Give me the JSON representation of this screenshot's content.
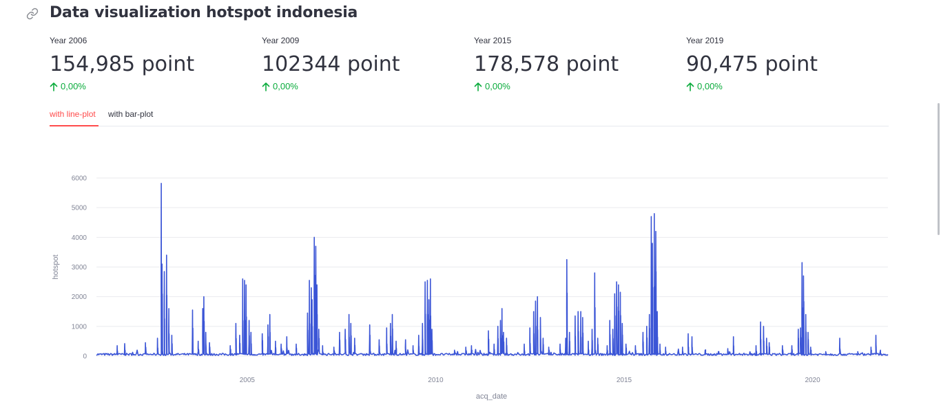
{
  "page": {
    "title": "Data visualization hotspot indonesia",
    "link_icon": "link-icon"
  },
  "metrics": [
    {
      "label": "Year 2006",
      "value": "154,985 point",
      "delta": "0,00%"
    },
    {
      "label": "Year 2009",
      "value": "102344 point",
      "delta": "0,00%"
    },
    {
      "label": "Year 2015",
      "value": "178,578 point",
      "delta": "0,00%"
    },
    {
      "label": "Year 2019",
      "value": "90,475 point",
      "delta": "0,00%"
    }
  ],
  "tabs": [
    {
      "label": "with line-plot",
      "active": true
    },
    {
      "label": "with bar-plot",
      "active": false
    }
  ],
  "colors": {
    "accent": "#ff4b4b",
    "delta_positive": "#09ab3b",
    "series": "#3b55d6",
    "text": "#31333f"
  },
  "chart_data": {
    "type": "line",
    "xlabel": "acq_date",
    "ylabel": "hotspot",
    "x_ticks": [
      "2005",
      "2010",
      "2015",
      "2020"
    ],
    "y_ticks": [
      "0",
      "1000",
      "2000",
      "3000",
      "4000",
      "5000",
      "6000"
    ],
    "xlim": [
      2001.0,
      2022.0
    ],
    "ylim": [
      0,
      6000
    ],
    "grid": true,
    "series": [
      {
        "peaks": [
          [
            2001.55,
            350
          ],
          [
            2001.75,
            420
          ],
          [
            2002.3,
            450
          ],
          [
            2002.62,
            600
          ],
          [
            2002.72,
            5820
          ],
          [
            2002.74,
            3100
          ],
          [
            2002.8,
            2850
          ],
          [
            2002.86,
            3400
          ],
          [
            2002.92,
            1600
          ],
          [
            2003.0,
            700
          ],
          [
            2003.55,
            1550
          ],
          [
            2003.7,
            500
          ],
          [
            2003.82,
            1600
          ],
          [
            2003.85,
            2000
          ],
          [
            2003.9,
            800
          ],
          [
            2004.0,
            450
          ],
          [
            2004.55,
            350
          ],
          [
            2004.7,
            1100
          ],
          [
            2004.8,
            700
          ],
          [
            2004.88,
            2600
          ],
          [
            2004.93,
            2550
          ],
          [
            2004.97,
            2400
          ],
          [
            2005.05,
            1200
          ],
          [
            2005.1,
            800
          ],
          [
            2005.4,
            750
          ],
          [
            2005.55,
            1050
          ],
          [
            2005.6,
            1400
          ],
          [
            2005.75,
            500
          ],
          [
            2005.9,
            400
          ],
          [
            2006.05,
            650
          ],
          [
            2006.3,
            400
          ],
          [
            2006.6,
            1450
          ],
          [
            2006.65,
            2550
          ],
          [
            2006.7,
            2300
          ],
          [
            2006.72,
            1900
          ],
          [
            2006.78,
            4000
          ],
          [
            2006.82,
            3700
          ],
          [
            2006.85,
            2400
          ],
          [
            2006.9,
            900
          ],
          [
            2007.0,
            350
          ],
          [
            2007.3,
            300
          ],
          [
            2007.45,
            800
          ],
          [
            2007.6,
            900
          ],
          [
            2007.7,
            1400
          ],
          [
            2007.75,
            1100
          ],
          [
            2007.85,
            600
          ],
          [
            2008.25,
            1050
          ],
          [
            2008.5,
            550
          ],
          [
            2008.7,
            950
          ],
          [
            2008.8,
            1100
          ],
          [
            2008.85,
            1400
          ],
          [
            2008.95,
            500
          ],
          [
            2009.2,
            550
          ],
          [
            2009.4,
            350
          ],
          [
            2009.55,
            700
          ],
          [
            2009.65,
            1100
          ],
          [
            2009.72,
            2500
          ],
          [
            2009.78,
            2550
          ],
          [
            2009.82,
            1900
          ],
          [
            2009.86,
            2600
          ],
          [
            2009.9,
            900
          ],
          [
            2010.5,
            200
          ],
          [
            2010.8,
            300
          ],
          [
            2010.95,
            350
          ],
          [
            2011.4,
            850
          ],
          [
            2011.55,
            400
          ],
          [
            2011.65,
            1000
          ],
          [
            2011.72,
            1200
          ],
          [
            2011.76,
            1600
          ],
          [
            2011.8,
            800
          ],
          [
            2011.88,
            600
          ],
          [
            2012.35,
            400
          ],
          [
            2012.5,
            950
          ],
          [
            2012.6,
            1500
          ],
          [
            2012.65,
            1850
          ],
          [
            2012.7,
            2000
          ],
          [
            2012.78,
            1300
          ],
          [
            2012.85,
            600
          ],
          [
            2013.0,
            300
          ],
          [
            2013.3,
            400
          ],
          [
            2013.45,
            600
          ],
          [
            2013.48,
            3250
          ],
          [
            2013.55,
            800
          ],
          [
            2013.7,
            1350
          ],
          [
            2013.78,
            1500
          ],
          [
            2013.85,
            1500
          ],
          [
            2013.9,
            1300
          ],
          [
            2014.05,
            500
          ],
          [
            2014.15,
            900
          ],
          [
            2014.22,
            2800
          ],
          [
            2014.3,
            600
          ],
          [
            2014.55,
            350
          ],
          [
            2014.62,
            1200
          ],
          [
            2014.7,
            900
          ],
          [
            2014.75,
            2100
          ],
          [
            2014.8,
            2500
          ],
          [
            2014.85,
            2400
          ],
          [
            2014.9,
            2150
          ],
          [
            2014.95,
            1100
          ],
          [
            2015.05,
            400
          ],
          [
            2015.3,
            350
          ],
          [
            2015.5,
            800
          ],
          [
            2015.6,
            1000
          ],
          [
            2015.67,
            1400
          ],
          [
            2015.72,
            4700
          ],
          [
            2015.75,
            3800
          ],
          [
            2015.8,
            4800
          ],
          [
            2015.84,
            4200
          ],
          [
            2015.88,
            1500
          ],
          [
            2015.95,
            400
          ],
          [
            2016.1,
            300
          ],
          [
            2016.55,
            300
          ],
          [
            2016.7,
            750
          ],
          [
            2016.8,
            650
          ],
          [
            2017.15,
            200
          ],
          [
            2017.5,
            150
          ],
          [
            2017.75,
            250
          ],
          [
            2017.9,
            650
          ],
          [
            2018.5,
            350
          ],
          [
            2018.62,
            1150
          ],
          [
            2018.7,
            1000
          ],
          [
            2018.78,
            600
          ],
          [
            2018.85,
            450
          ],
          [
            2019.2,
            350
          ],
          [
            2019.45,
            350
          ],
          [
            2019.62,
            900
          ],
          [
            2019.68,
            950
          ],
          [
            2019.72,
            3150
          ],
          [
            2019.76,
            2700
          ],
          [
            2019.82,
            1400
          ],
          [
            2019.88,
            800
          ],
          [
            2019.95,
            300
          ],
          [
            2020.35,
            150
          ],
          [
            2020.72,
            600
          ],
          [
            2021.2,
            150
          ],
          [
            2021.55,
            300
          ],
          [
            2021.68,
            700
          ],
          [
            2021.8,
            200
          ]
        ]
      }
    ]
  }
}
